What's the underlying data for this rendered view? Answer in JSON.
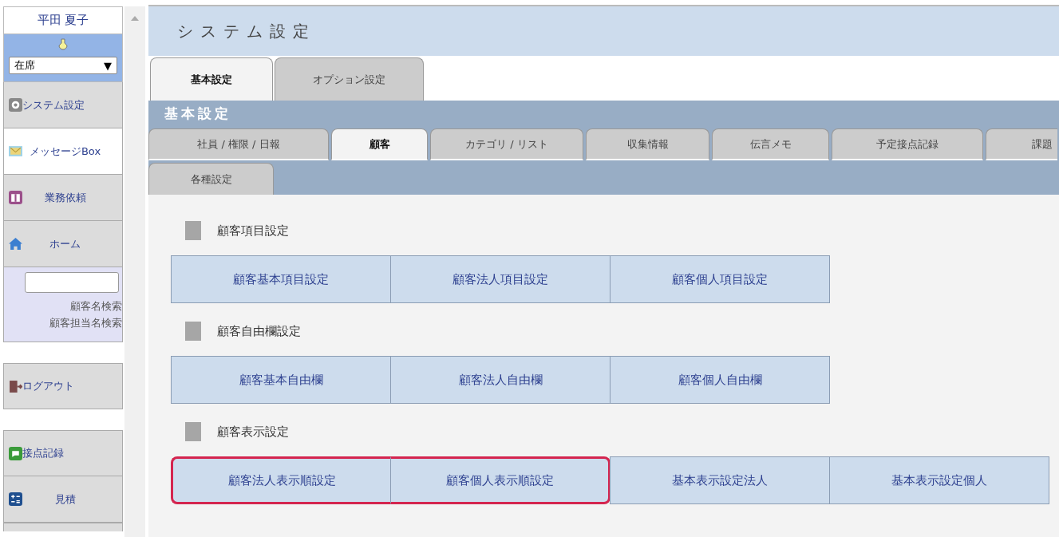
{
  "sidebar": {
    "user_name": "平田 夏子",
    "status_select": {
      "value": "在席",
      "arrow": "▼"
    },
    "menu_top": [
      {
        "label": "システム設定",
        "kind": "gear",
        "selected": false
      },
      {
        "label": "メッセージBox",
        "kind": "mail",
        "selected": true
      },
      {
        "label": "業務依頼",
        "kind": "gift",
        "selected": false
      },
      {
        "label": "ホーム",
        "kind": "home",
        "selected": false
      }
    ],
    "search": {
      "links": [
        "顧客名検索",
        "顧客担当名検索"
      ]
    },
    "menu_logout": [
      {
        "label": "ログアウト",
        "kind": "door",
        "selected": false
      }
    ],
    "menu_bottom": [
      {
        "label": "接点記録",
        "kind": "chat",
        "selected": false
      },
      {
        "label": "見積",
        "kind": "calc",
        "selected": false
      }
    ]
  },
  "page_title": "システム設定",
  "top_tabs": [
    {
      "label": "基本設定",
      "selected": true
    },
    {
      "label": "オプション設定",
      "selected": false
    }
  ],
  "section_title": "基本設定",
  "sub_tabs": [
    [
      {
        "label": "社員 / 権限 / 日報",
        "selected": false
      },
      {
        "label": "顧客",
        "selected": true
      },
      {
        "label": "カテゴリ / リスト",
        "selected": false
      },
      {
        "label": "収集情報",
        "selected": false
      },
      {
        "label": "伝言メモ",
        "selected": false
      },
      {
        "label": "予定接点記録",
        "selected": false
      },
      {
        "label": "課題",
        "selected": false
      }
    ],
    [
      {
        "label": "各種設定",
        "selected": false
      }
    ]
  ],
  "groups": [
    {
      "heading": "顧客項目設定",
      "buttons": [
        {
          "label": "顧客基本項目設定",
          "highlighted": false
        },
        {
          "label": "顧客法人項目設定",
          "highlighted": false
        },
        {
          "label": "顧客個人項目設定",
          "highlighted": false
        }
      ]
    },
    {
      "heading": "顧客自由欄設定",
      "buttons": [
        {
          "label": "顧客基本自由欄",
          "highlighted": false
        },
        {
          "label": "顧客法人自由欄",
          "highlighted": false
        },
        {
          "label": "顧客個人自由欄",
          "highlighted": false
        }
      ]
    },
    {
      "heading": "顧客表示設定",
      "buttons": [
        {
          "label": "顧客法人表示順設定",
          "highlighted": true
        },
        {
          "label": "顧客個人表示順設定",
          "highlighted": true
        },
        {
          "label": "基本表示設定法人",
          "highlighted": false
        },
        {
          "label": "基本表示設定個人",
          "highlighted": false
        }
      ]
    }
  ]
}
